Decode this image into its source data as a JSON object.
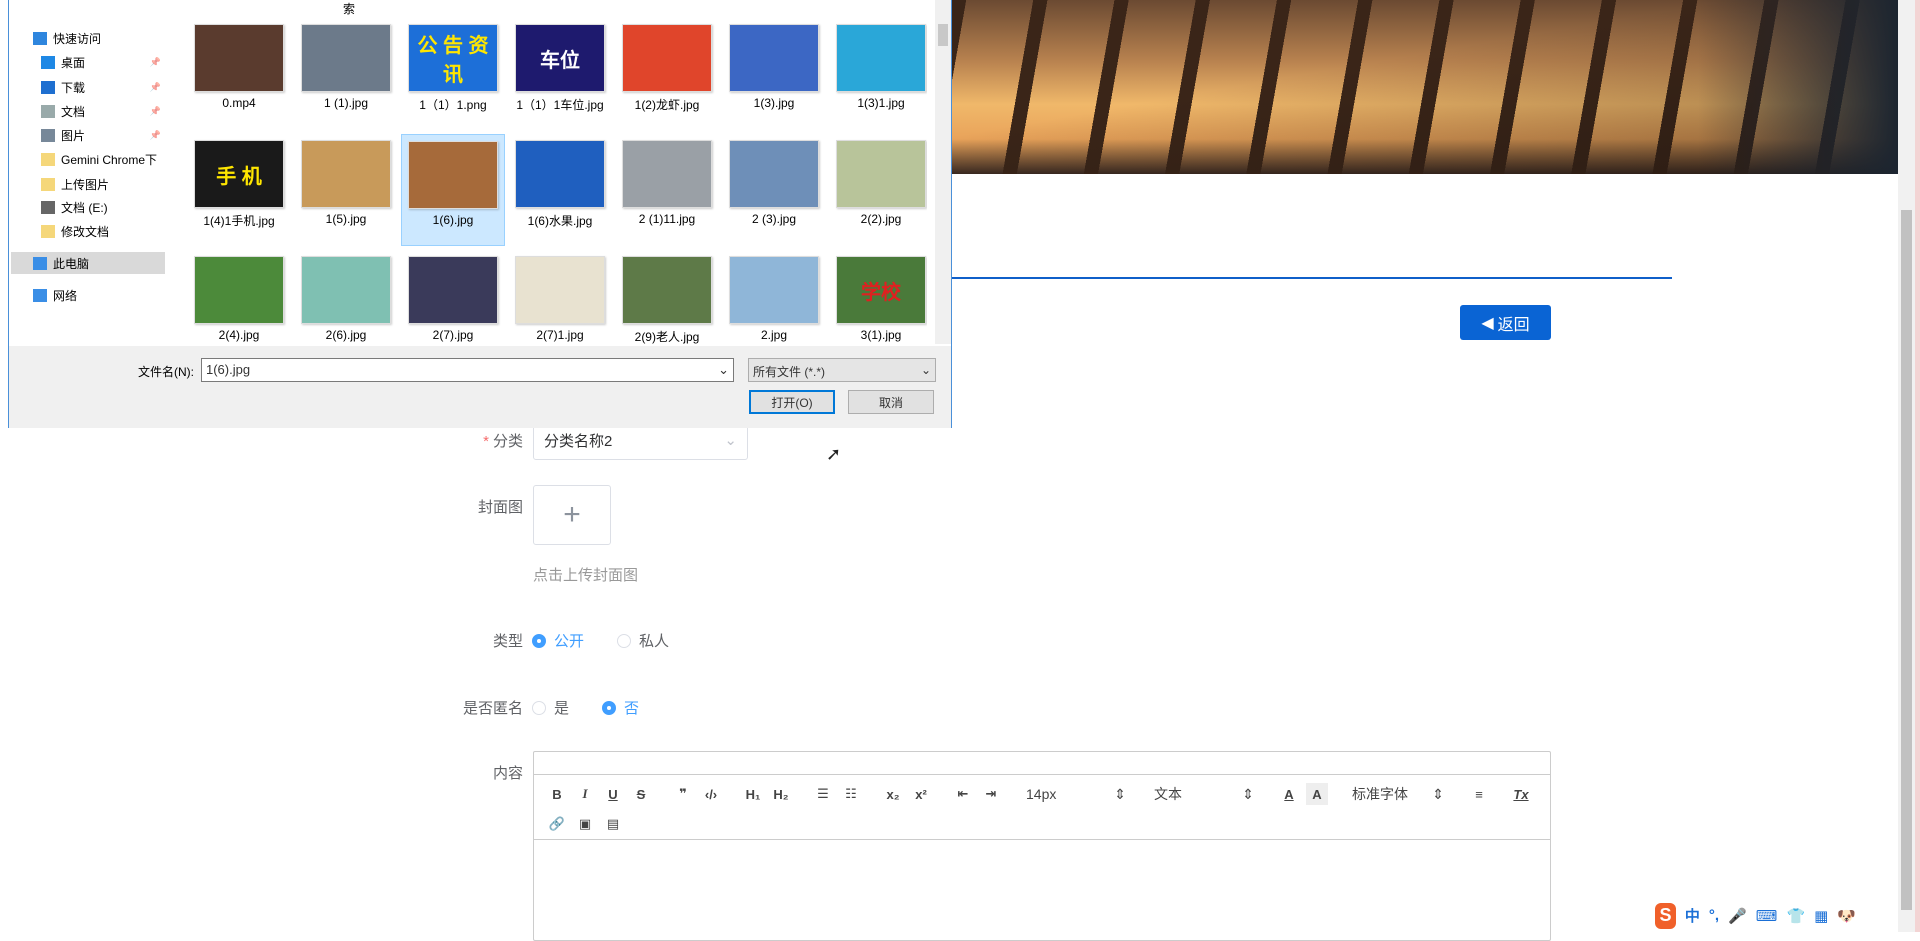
{
  "page": {
    "back_label": "返回",
    "form": {
      "category_label": "分类",
      "category_value": "分类名称2",
      "cover_label": "封面图",
      "cover_hint": "点击上传封面图",
      "type_label": "类型",
      "type_options": [
        "公开",
        "私人"
      ],
      "type_selected": "公开",
      "anon_label": "是否匿名",
      "anon_options": [
        "是",
        "否"
      ],
      "anon_selected": "否",
      "content_label": "内容"
    },
    "editor_toolbar": {
      "bold": "B",
      "italic": "I",
      "underline": "U",
      "strike": "S",
      "quote": "❞",
      "code": "‹/›",
      "h1": "H₁",
      "h2": "H₂",
      "ol": "☰",
      "ul": "☷",
      "sub": "x₂",
      "sup": "x²",
      "outdent": "⇤",
      "indent": "⇥",
      "size": "14px",
      "header": "文本",
      "color": "A",
      "bg": "A",
      "font": "标准字体",
      "align": "≡",
      "clean": "Tx",
      "link": "🔗",
      "image": "▣",
      "video": "▤"
    }
  },
  "dialog": {
    "title_fragment": "索",
    "nav": [
      {
        "label": "快速访问",
        "icon": "star-icon"
      },
      {
        "label": "桌面",
        "icon": "desktop-icon",
        "pinned": true
      },
      {
        "label": "下载",
        "icon": "download-icon",
        "pinned": true
      },
      {
        "label": "文档",
        "icon": "document-icon",
        "pinned": true
      },
      {
        "label": "图片",
        "icon": "pictures-icon",
        "pinned": true
      },
      {
        "label": "Gemini Chrome下",
        "icon": "folder-icon"
      },
      {
        "label": "上传图片",
        "icon": "folder-icon"
      },
      {
        "label": "文档 (E:)",
        "icon": "drive-icon"
      },
      {
        "label": "修改文档",
        "icon": "folder-icon"
      },
      {
        "label": "此电脑",
        "icon": "computer-icon"
      },
      {
        "label": "网络",
        "icon": "network-icon"
      }
    ],
    "files": [
      {
        "name": "0.mp4",
        "color": "#5a3b2e"
      },
      {
        "name": "1 (1).jpg",
        "color": "#6c7a8a"
      },
      {
        "name": "1（1）1.png",
        "color": "#1d6fd8",
        "text": "公 告 资 讯"
      },
      {
        "name": "1（1）1车位.jpg",
        "color": "#1e1a6e",
        "text": "车位"
      },
      {
        "name": "1(2)龙虾.jpg",
        "color": "#e0452b"
      },
      {
        "name": "1(3).jpg",
        "color": "#3c67c4"
      },
      {
        "name": "1(3)1.jpg",
        "color": "#2aa7d8"
      },
      {
        "name": "1(4)1手机.jpg",
        "color": "#1a1a1a",
        "text": "手 机"
      },
      {
        "name": "1(5).jpg",
        "color": "#c89a5a"
      },
      {
        "name": "1(6).jpg",
        "color": "#a66a3a",
        "selected": true
      },
      {
        "name": "1(6)水果.jpg",
        "color": "#1f5fbf"
      },
      {
        "name": "2 (1)11.jpg",
        "color": "#9aa0a6"
      },
      {
        "name": "2 (3).jpg",
        "color": "#6e8fb8"
      },
      {
        "name": "2(2).jpg",
        "color": "#b8c49a"
      },
      {
        "name": "2(4).jpg",
        "color": "#4c8a3a"
      },
      {
        "name": "2(6).jpg",
        "color": "#7fc0b2"
      },
      {
        "name": "2(7).jpg",
        "color": "#3a3a5a"
      },
      {
        "name": "2(7)1.jpg",
        "color": "#e8e2d0"
      },
      {
        "name": "2(9)老人.jpg",
        "color": "#5e7a48"
      },
      {
        "name": "2.jpg",
        "color": "#8fb6d8"
      },
      {
        "name": "3(1).jpg",
        "color": "#4a7a3a",
        "text": "学校"
      }
    ],
    "filename_label": "文件名(N):",
    "filename_value": "1(6).jpg",
    "filetype_value": "所有文件 (*.*)",
    "open_label": "打开(O)",
    "cancel_label": "取消"
  },
  "ime": {
    "logo": "S",
    "items": [
      "中",
      "°,",
      "🎤",
      "⌨",
      "👕",
      "▦",
      "🐶"
    ]
  }
}
